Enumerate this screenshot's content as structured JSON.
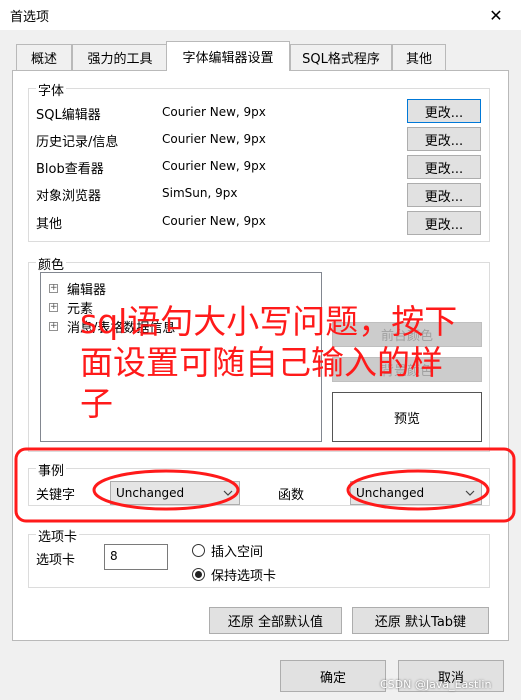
{
  "window": {
    "title": "首选项",
    "close_label": "✕"
  },
  "tabs": [
    {
      "label": "概述",
      "active": false
    },
    {
      "label": "强力的工具",
      "active": false
    },
    {
      "label": "字体编辑器设置",
      "active": true
    },
    {
      "label": "SQL格式程序",
      "active": false
    },
    {
      "label": "其他",
      "active": false
    }
  ],
  "fonts": {
    "label": "字体",
    "rows": [
      {
        "label": "SQL编辑器",
        "value": "Courier New, 9px",
        "button": "更改..."
      },
      {
        "label": "历史记录/信息",
        "value": "Courier New, 9px",
        "button": "更改..."
      },
      {
        "label": "Blob查看器",
        "value": "Courier New, 9px",
        "button": "更改..."
      },
      {
        "label": "对象浏览器",
        "value": "SimSun, 9px",
        "button": "更改..."
      },
      {
        "label": "其他",
        "value": "Courier New, 9px",
        "button": "更改..."
      }
    ]
  },
  "colors": {
    "label": "颜色",
    "tree": [
      {
        "label": "编辑器",
        "toggle": "+"
      },
      {
        "label": "元素",
        "toggle": "+"
      },
      {
        "label": "消息/表格数据信息",
        "toggle": "+"
      }
    ],
    "foreground_button": "前台颜色",
    "background_button": "背景颜色",
    "preview_label": "预览"
  },
  "case": {
    "label": "事例",
    "keyword_label": "关键字",
    "keyword_value": "Unchanged",
    "function_label": "函数",
    "function_value": "Unchanged"
  },
  "tabs_group": {
    "label": "选项卡",
    "size_label": "选项卡",
    "size_value": "8",
    "insert_spaces_label": "插入空间",
    "keep_tabs_label": "保持选项卡"
  },
  "buttons": {
    "restore_all": "还原 全部默认值",
    "restore_tab": "还原 默认Tab键",
    "ok": "确定",
    "cancel": "取消"
  },
  "annotation": {
    "text_line1": "sql语句大小写问题，按下",
    "text_line2": "面设置可随自己输入的样",
    "text_line3": "子",
    "color": "#ff1a1a"
  },
  "watermark": "CSDN @Java_Eastlin"
}
